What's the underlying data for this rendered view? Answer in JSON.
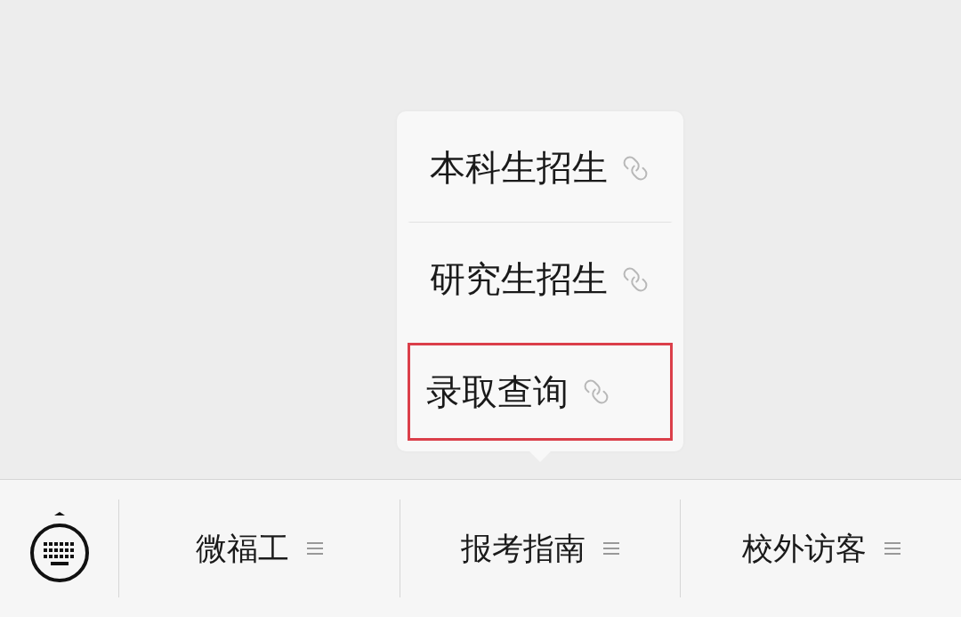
{
  "popup_menu": {
    "items": [
      {
        "label": "本科生招生",
        "highlighted": false
      },
      {
        "label": "研究生招生",
        "highlighted": false
      },
      {
        "label": "录取查询",
        "highlighted": true
      }
    ]
  },
  "menu_bar": {
    "items": [
      {
        "label": "微福工",
        "expanded": false
      },
      {
        "label": "报考指南",
        "expanded": true
      },
      {
        "label": "校外访客",
        "expanded": false
      }
    ]
  }
}
